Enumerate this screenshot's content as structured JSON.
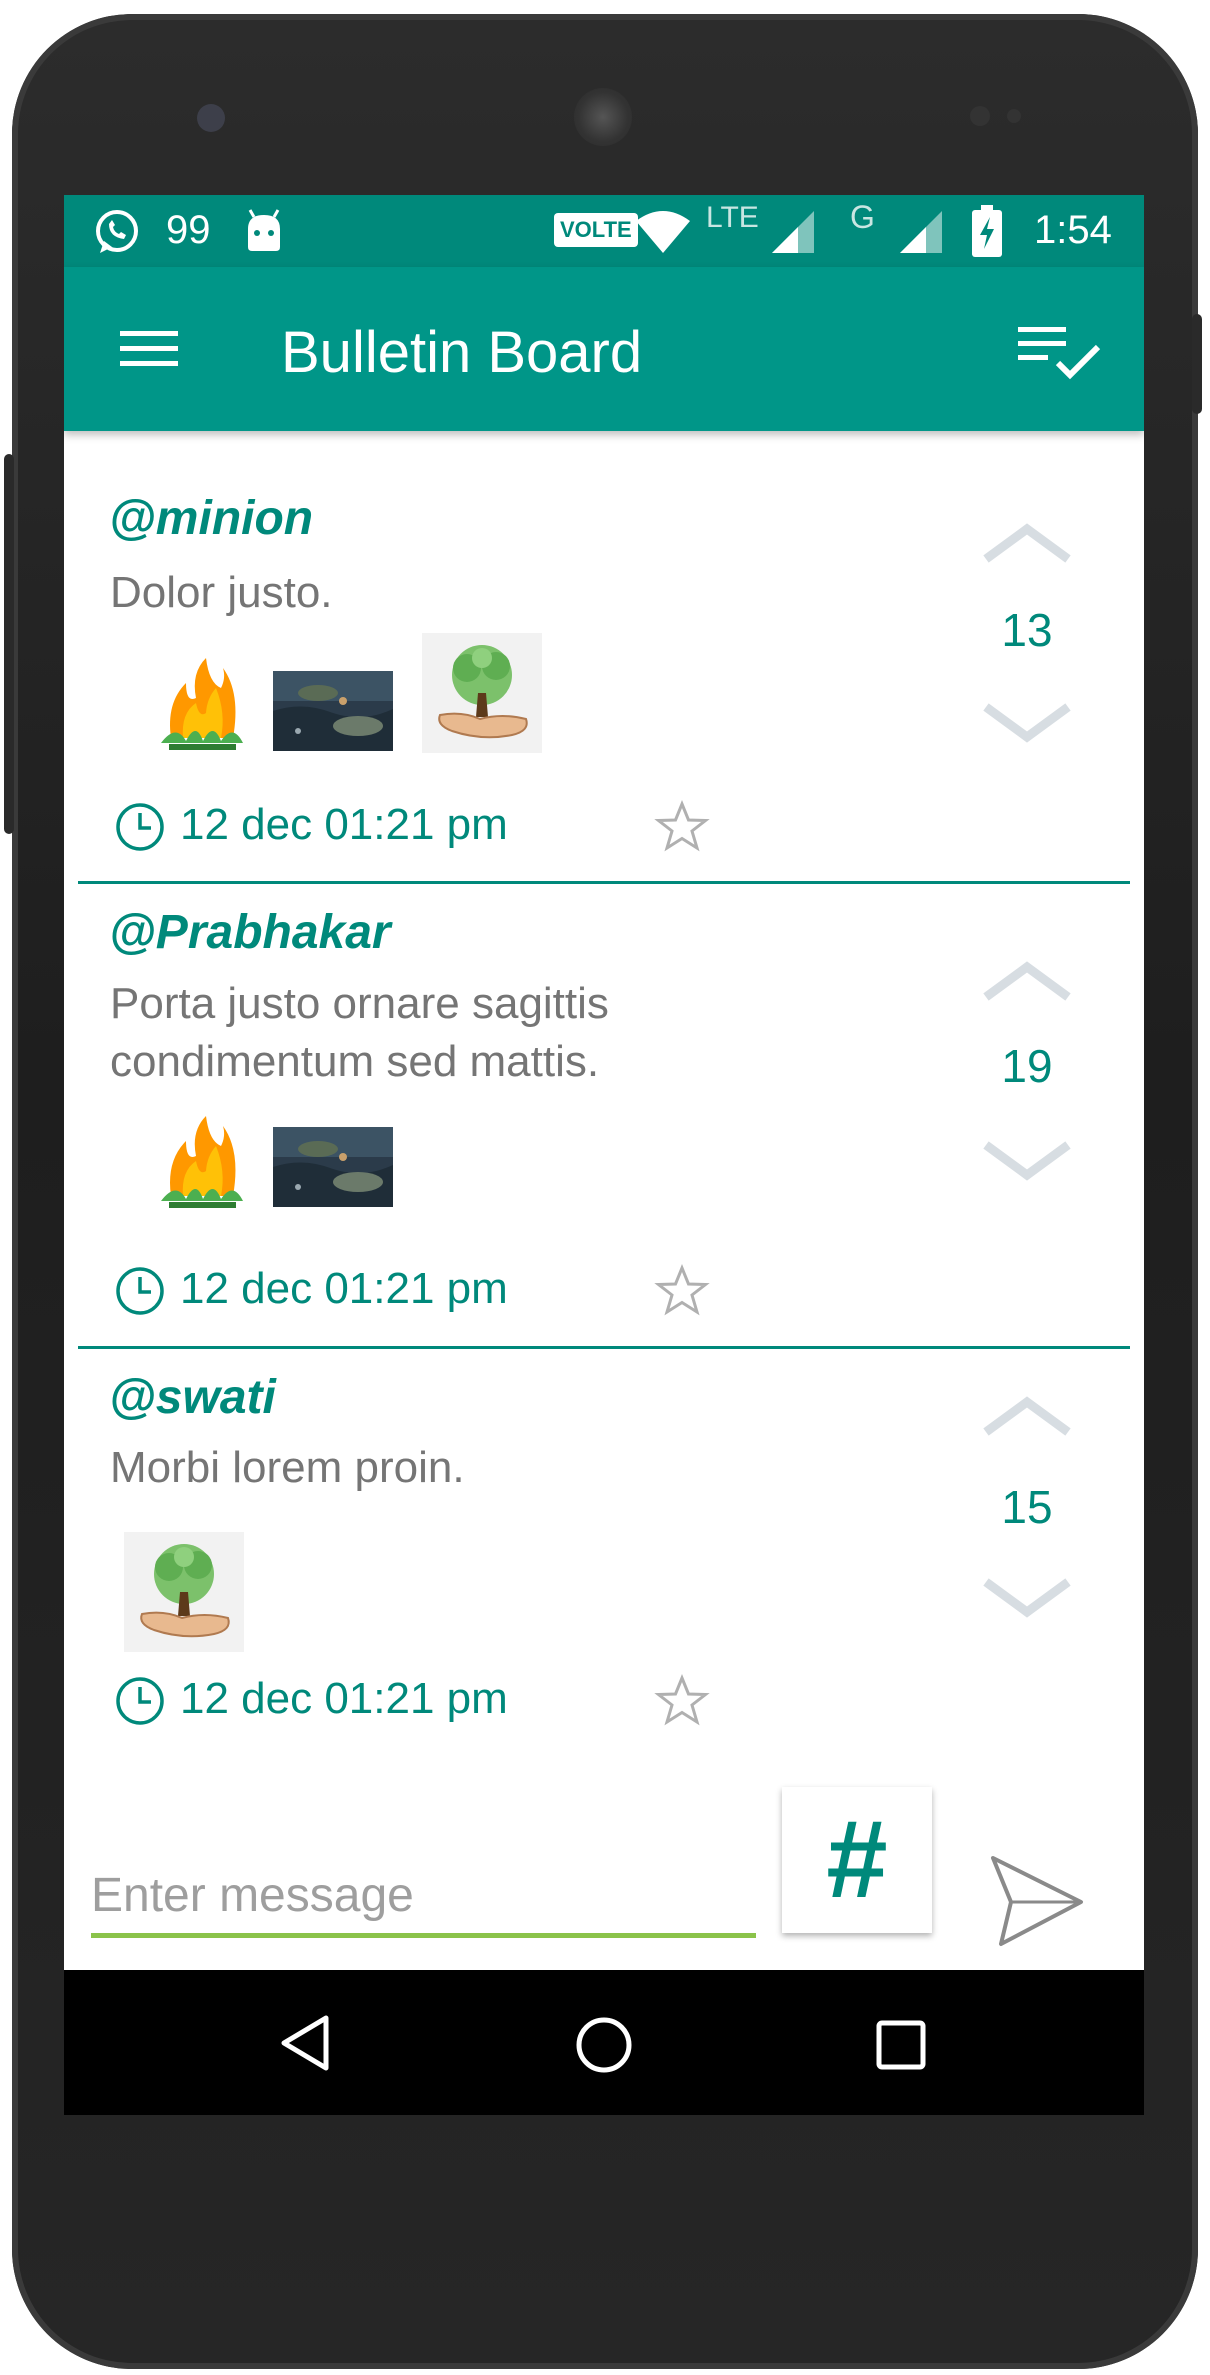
{
  "status_bar": {
    "notification_count": "99",
    "network_badge": "VOLTE",
    "lte_label": "LTE",
    "g_label": "G",
    "time": "1:54"
  },
  "app_bar": {
    "title": "Bulletin Board",
    "menu_icon": "hamburger-menu-icon",
    "action_icon": "checklist-icon"
  },
  "posts": [
    {
      "author": "@minion",
      "text": "Dolor justo.",
      "votes": "13",
      "timestamp": "12 dec 01:21 pm",
      "attachments": [
        "fire-plant-image",
        "water-photo-image",
        "tree-in-hand-image"
      ]
    },
    {
      "author": "@Prabhakar",
      "text": "Porta justo ornare sagittis condimentum sed mattis.",
      "votes": "19",
      "timestamp": "12 dec 01:21 pm",
      "attachments": [
        "fire-plant-image",
        "water-photo-image"
      ]
    },
    {
      "author": "@swati",
      "text": "Morbi lorem proin.",
      "votes": "15",
      "timestamp": "12 dec 01:21 pm",
      "attachments": [
        "tree-in-hand-image"
      ]
    }
  ],
  "composer": {
    "placeholder": "Enter message",
    "hashtag_label": "#",
    "send_icon": "send-icon"
  },
  "colors": {
    "status_bar": "#00897b",
    "app_bar": "#009688",
    "accent": "#00897b",
    "input_underline": "#8bc34a",
    "body_text": "#757575"
  }
}
